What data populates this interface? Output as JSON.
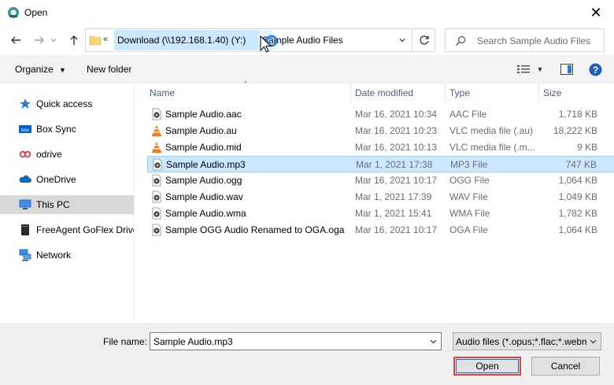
{
  "window": {
    "title": "Open"
  },
  "address": {
    "overflow": "«",
    "segments": [
      "Download (\\\\192.168.1.40) (Y:)",
      "Sample Audio Files"
    ],
    "separator": "›"
  },
  "search": {
    "placeholder": "Search Sample Audio Files"
  },
  "toolbar": {
    "organize": "Organize",
    "new_folder": "New folder",
    "help": "?"
  },
  "sidebar": {
    "items": [
      {
        "label": "Quick access",
        "icon": "star-icon"
      },
      {
        "label": "Box Sync",
        "icon": "box-icon"
      },
      {
        "label": "odrive",
        "icon": "odrive-icon"
      },
      {
        "label": "OneDrive",
        "icon": "cloud-icon"
      },
      {
        "label": "This PC",
        "icon": "computer-icon",
        "selected": true
      },
      {
        "label": "FreeAgent GoFlex Drive",
        "icon": "drive-icon"
      },
      {
        "label": "Network",
        "icon": "network-icon"
      }
    ]
  },
  "columns": {
    "name": "Name",
    "date": "Date modified",
    "type": "Type",
    "size": "Size"
  },
  "files": [
    {
      "name": "Sample Audio.aac",
      "date": "Mar 16, 2021 10:34",
      "type": "AAC File",
      "size": "1,718 KB",
      "icon": "audio-file-icon"
    },
    {
      "name": "Sample Audio.au",
      "date": "Mar 16, 2021 10:23",
      "type": "VLC media file (.au)",
      "size": "18,222 KB",
      "icon": "vlc-icon"
    },
    {
      "name": "Sample Audio.mid",
      "date": "Mar 16, 2021 10:13",
      "type": "VLC media file (.m...",
      "size": "9 KB",
      "icon": "vlc-icon"
    },
    {
      "name": "Sample Audio.mp3",
      "date": "Mar 1, 2021 17:38",
      "type": "MP3 File",
      "size": "747 KB",
      "icon": "audio-file-icon",
      "selected": true
    },
    {
      "name": "Sample Audio.ogg",
      "date": "Mar 16, 2021 10:17",
      "type": "OGG File",
      "size": "1,064 KB",
      "icon": "audio-file-icon"
    },
    {
      "name": "Sample Audio.wav",
      "date": "Mar 1, 2021 17:39",
      "type": "WAV File",
      "size": "1,049 KB",
      "icon": "audio-file-icon"
    },
    {
      "name": "Sample Audio.wma",
      "date": "Mar 1, 2021 15:41",
      "type": "WMA File",
      "size": "1,782 KB",
      "icon": "audio-file-icon"
    },
    {
      "name": "Sample OGG Audio Renamed to OGA.oga",
      "date": "Mar 16, 2021 10:17",
      "type": "OGA File",
      "size": "1,064 KB",
      "icon": "audio-file-icon"
    }
  ],
  "footer": {
    "file_name_label": "File name:",
    "file_name_value": "Sample Audio.mp3",
    "filter_value": "Audio files (*.opus;*.flac;*.webm",
    "open_label": "Open",
    "cancel_label": "Cancel"
  },
  "colors": {
    "selection": "#cce8ff",
    "selection_border": "#99d1ff",
    "highlight_box": "#e0463a",
    "accent": "#0078d7"
  }
}
